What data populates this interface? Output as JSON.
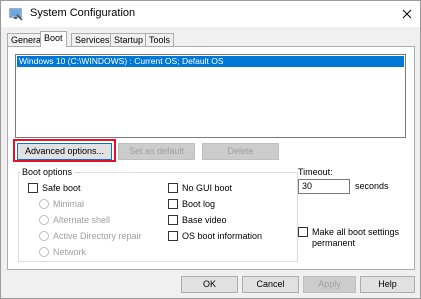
{
  "window": {
    "title": "System Configuration"
  },
  "tabs": [
    {
      "label": "General",
      "active": false
    },
    {
      "label": "Boot",
      "active": true
    },
    {
      "label": "Services",
      "active": false
    },
    {
      "label": "Startup",
      "active": false
    },
    {
      "label": "Tools",
      "active": false
    }
  ],
  "os_list": {
    "entries": [
      "Windows 10 (C:\\WINDOWS) : Current OS; Default OS"
    ]
  },
  "buttons": {
    "advanced": "Advanced options...",
    "set_default": "Set as default",
    "delete": "Delete",
    "ok": "OK",
    "cancel": "Cancel",
    "apply": "Apply",
    "help": "Help"
  },
  "boot_options": {
    "label": "Boot options",
    "safe_boot": "Safe boot",
    "minimal": "Minimal",
    "alternate_shell": "Alternate shell",
    "active_directory_repair": "Active Directory repair",
    "network": "Network",
    "no_gui_boot": "No GUI boot",
    "boot_log": "Boot log",
    "base_video": "Base video",
    "os_boot_information": "OS boot information"
  },
  "timeout": {
    "label": "Timeout:",
    "value": "30",
    "unit": "seconds"
  },
  "make_permanent": {
    "line1": "Make all boot settings",
    "line2": "permanent"
  },
  "colors": {
    "selection": "#0078d7",
    "highlight_box": "#e81123"
  }
}
